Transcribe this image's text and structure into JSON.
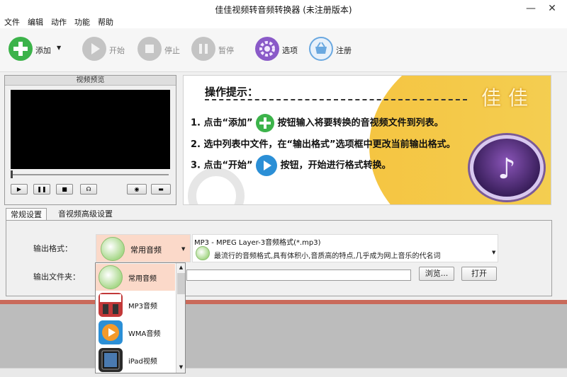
{
  "window": {
    "title": "佳佳视频转音频转换器 (未注册版本)",
    "minimize_glyph": "—",
    "close_glyph": "✕"
  },
  "menu": [
    "文件",
    "编辑",
    "动作",
    "功能",
    "帮助"
  ],
  "toolbar": {
    "add": "添加",
    "start": "开始",
    "stop": "停止",
    "pause": "暂停",
    "options": "选项",
    "register": "注册"
  },
  "preview": {
    "title": "视频预览",
    "play_glyph": "▶",
    "pause_glyph": "❚❚",
    "stop_glyph": "■",
    "volume_glyph": "☊",
    "snapshot_glyph": "◉",
    "folder_glyph": "▬"
  },
  "banner": {
    "title": "操作提示：",
    "step1_before": "1. 点击“添加”",
    "step1_after": "按钮输入将要转换的音视频文件到列表。",
    "step2": "2. 选中列表中文件，在“输出格式”选项框中更改当前输出格式。",
    "step3_before": "3. 点击“开始”",
    "step3_after": "按钮，开始进行格式转换。",
    "brand": "佳佳",
    "note_glyph": "♪"
  },
  "tabs": [
    "常规设置",
    "音视频高级设置"
  ],
  "settings": {
    "output_format_label": "输出格式：",
    "output_folder_label": "输出文件夹：",
    "format_category": "常用音频",
    "format_name": "MP3 - MPEG Layer-3音频格式(*.mp3)",
    "format_desc": "最流行的音频格式,具有体积小,音质高的特点,几乎成为网上音乐的代名词",
    "browse": "浏览...",
    "open": "打开"
  },
  "dropdown": {
    "items": [
      "常用音频",
      "MP3音频",
      "WMA音频",
      "iPad视频"
    ]
  },
  "colors": {
    "add_green": "#3cb34a",
    "disabled_gray": "#b9b9b9",
    "options_purple": "#8a5ac8",
    "register_blue": "#6aa8e0",
    "banner_yellow": "#f5c542",
    "selected_orange": "#fbd9c9"
  }
}
